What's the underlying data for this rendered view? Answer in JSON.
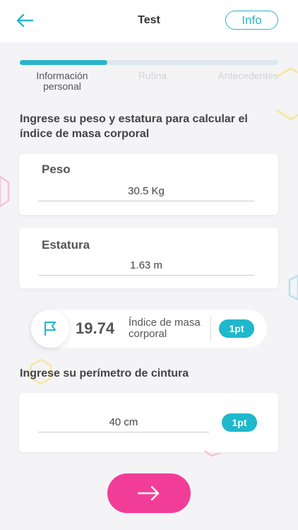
{
  "header": {
    "title": "Test",
    "info_label": "Info"
  },
  "progress": {
    "fraction": 0.34
  },
  "steps": [
    {
      "label": "Información personal",
      "active": true
    },
    {
      "label": "Rutina",
      "active": false
    },
    {
      "label": "Antecedentes",
      "active": false
    }
  ],
  "bmi_section": {
    "prompt": "Ingrese su peso y estatura para calcular el índice de masa corporal",
    "weight": {
      "label": "Peso",
      "value": "30.5 Kg"
    },
    "height": {
      "label": "Estatura",
      "value": "1.63 m"
    }
  },
  "result": {
    "value": "19.74",
    "label": "Índice de masa corporal",
    "points": "1pt"
  },
  "waist_section": {
    "prompt": "Ingrese su perímetro de cintura",
    "value": "40 cm",
    "points": "1pt"
  },
  "colors": {
    "accent": "#2ab6cb",
    "primary_button": "#f23d98",
    "background": "#f4f4f6"
  }
}
